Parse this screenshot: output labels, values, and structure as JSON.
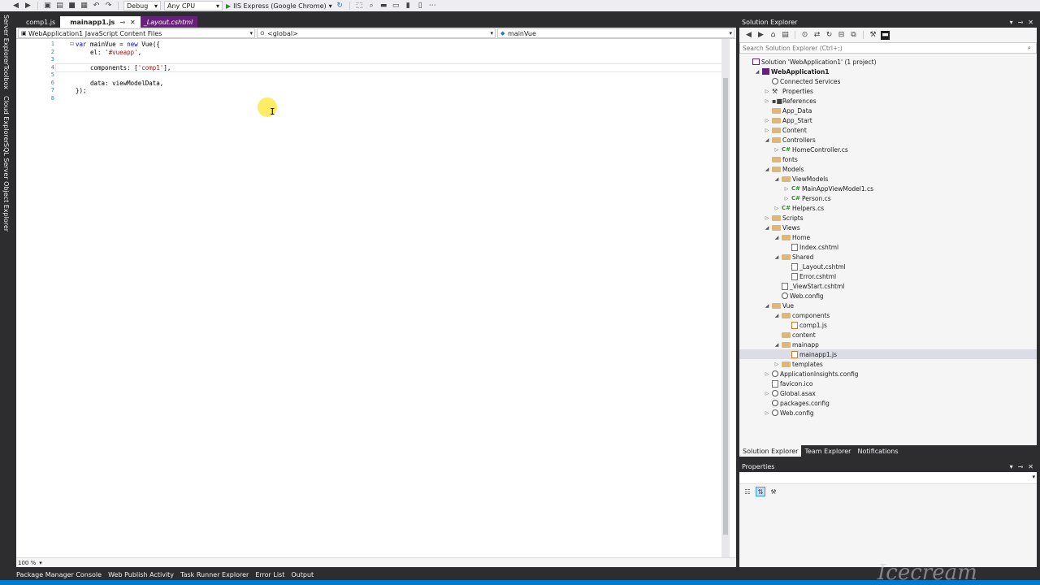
{
  "toolbar": {
    "config_value": "Debug",
    "platform_value": "Any CPU",
    "run_label": "IIS Express (Google Chrome)"
  },
  "left_strip": {
    "tabs": [
      "Server Explorer",
      "Toolbox",
      "Cloud Explorer",
      "SQL Server Object Explorer"
    ]
  },
  "doc_tabs": [
    {
      "label": "comp1.js"
    },
    {
      "label": "mainapp1.js",
      "close": "✕"
    },
    {
      "label": "_Layout.cshtml"
    }
  ],
  "navbar": {
    "project": "WebApplication1 JavaScript Content Files",
    "scope": "<global>",
    "member": "mainVue"
  },
  "editor": {
    "lines": [
      "1",
      "2",
      "3",
      "4",
      "5",
      "6",
      "7",
      "8"
    ],
    "code": {
      "l1_kw1": "var",
      "l1_rest": " mainVue = ",
      "l1_kw2": "new",
      "l1_tail": " Vue({",
      "l2_key": "el: ",
      "l2_str": "'#vueapp'",
      "l2_tail": ",",
      "l4_key": "components: [",
      "l4_str": "'comp1'",
      "l4_tail": "],",
      "l6": "data: viewModelData,",
      "l7": "});"
    },
    "zoom": "100 %"
  },
  "bottom_tabs": [
    "Package Manager Console",
    "Web Publish Activity",
    "Task Runner Explorer",
    "Error List",
    "Output"
  ],
  "solution_explorer": {
    "title": "Solution Explorer",
    "search_placeholder": "Search Solution Explorer (Ctrl+;)",
    "tree": [
      {
        "label": "Solution 'WebApplication1' (1 project)",
        "icon": "solution-icon"
      },
      {
        "label": "WebApplication1",
        "icon": "project-icon"
      },
      {
        "label": "Connected Services",
        "icon": "connected-services-icon"
      },
      {
        "label": "Properties",
        "icon": "wrench-icon"
      },
      {
        "label": "References",
        "icon": "references-icon"
      },
      {
        "label": "App_Data",
        "icon": "folder-icon"
      },
      {
        "label": "App_Start",
        "icon": "folder-icon"
      },
      {
        "label": "Content",
        "icon": "folder-icon"
      },
      {
        "label": "Controllers",
        "icon": "folder-icon"
      },
      {
        "label": "HomeController.cs",
        "icon": "csharp-file-icon"
      },
      {
        "label": "fonts",
        "icon": "folder-icon"
      },
      {
        "label": "Models",
        "icon": "folder-icon"
      },
      {
        "label": "ViewModels",
        "icon": "folder-icon"
      },
      {
        "label": "MainAppViewModel1.cs",
        "icon": "csharp-file-icon"
      },
      {
        "label": "Person.cs",
        "icon": "csharp-file-icon"
      },
      {
        "label": "Helpers.cs",
        "icon": "csharp-file-icon"
      },
      {
        "label": "Scripts",
        "icon": "folder-icon"
      },
      {
        "label": "Views",
        "icon": "folder-icon"
      },
      {
        "label": "Home",
        "icon": "folder-icon"
      },
      {
        "label": "Index.cshtml",
        "icon": "razor-file-icon"
      },
      {
        "label": "Shared",
        "icon": "folder-icon"
      },
      {
        "label": "_Layout.cshtml",
        "icon": "razor-file-icon"
      },
      {
        "label": "Error.cshtml",
        "icon": "razor-file-icon"
      },
      {
        "label": "_ViewStart.cshtml",
        "icon": "razor-file-icon"
      },
      {
        "label": "Web.config",
        "icon": "config-file-icon"
      },
      {
        "label": "Vue",
        "icon": "folder-icon"
      },
      {
        "label": "components",
        "icon": "folder-icon"
      },
      {
        "label": "comp1.js",
        "icon": "js-file-icon"
      },
      {
        "label": "content",
        "icon": "folder-icon"
      },
      {
        "label": "mainapp",
        "icon": "folder-icon"
      },
      {
        "label": "mainapp1.js",
        "icon": "js-file-icon",
        "selected": true
      },
      {
        "label": "templates",
        "icon": "folder-icon"
      },
      {
        "label": "ApplicationInsights.config",
        "icon": "config-file-icon"
      },
      {
        "label": "favicon.ico",
        "icon": "file-icon"
      },
      {
        "label": "Global.asax",
        "icon": "config-file-icon"
      },
      {
        "label": "packages.config",
        "icon": "config-file-icon"
      },
      {
        "label": "Web.config",
        "icon": "config-file-icon"
      }
    ],
    "tabs": [
      "Solution Explorer",
      "Team Explorer",
      "Notifications"
    ]
  },
  "properties": {
    "title": "Properties"
  },
  "watermark": "Icecream",
  "colors": {
    "accent": "#007acc",
    "chrome_dark": "#2d2d30",
    "preview_tab": "#68217a"
  }
}
